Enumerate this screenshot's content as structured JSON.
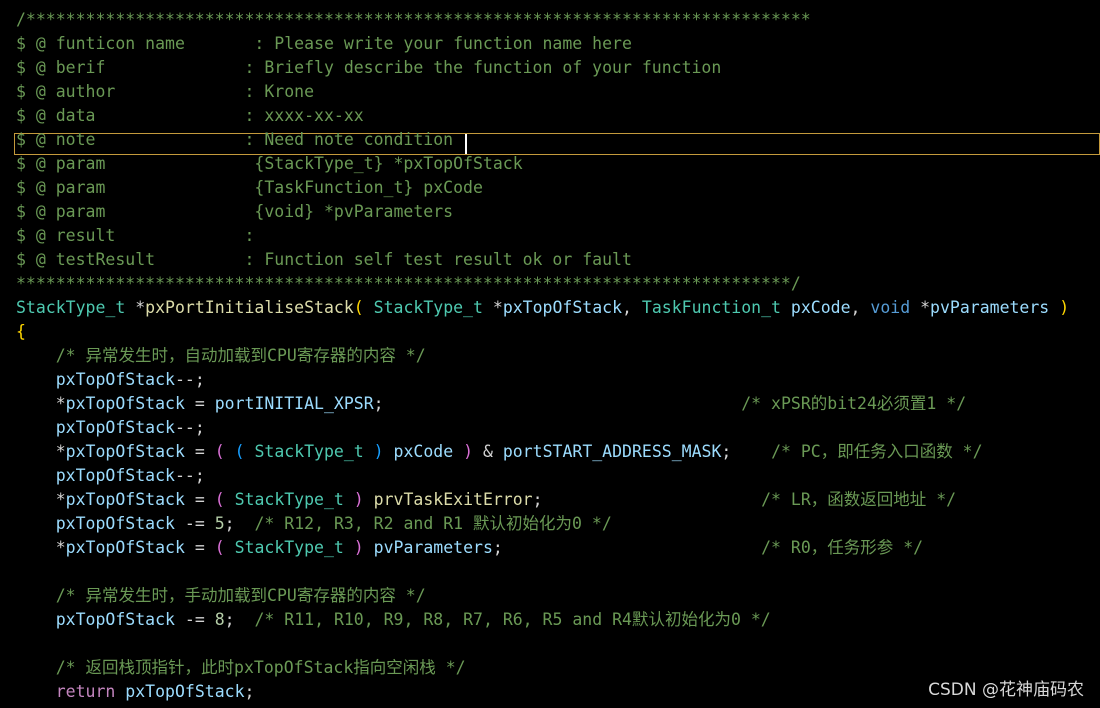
{
  "colors": {
    "background": "#000000",
    "plain": "#d4d4d4",
    "comment": "#6a9955",
    "type": "#4ec9b0",
    "identifier": "#9cdcfe",
    "function": "#dcdcaa",
    "keyword": "#569cd6",
    "control_keyword": "#c586c0",
    "bracket_gold": "#ffd700",
    "bracket_violet": "#da70d6",
    "bracket_blue": "#179fff",
    "number": "#b5cea8",
    "current_line_border": "#c49a3c"
  },
  "code_lines": [
    [
      [
        "/*******************************************************************************",
        "comment"
      ]
    ],
    [
      [
        "$ @ funticon name       : Please write your function name here",
        "comment"
      ]
    ],
    [
      [
        "$ @ berif              : Briefly describe the function of your function",
        "comment"
      ]
    ],
    [
      [
        "$ @ author             : Krone",
        "comment"
      ]
    ],
    [
      [
        "$ @ data               : xxxx-xx-xx",
        "comment"
      ]
    ],
    [
      [
        "$ @ note               : Need note condition",
        "comment"
      ]
    ],
    [
      [
        "$ @ param               {StackType_t} *pxTopOfStack",
        "comment"
      ]
    ],
    [
      [
        "$ @ param               {TaskFunction_t} pxCode",
        "comment"
      ]
    ],
    [
      [
        "$ @ param               {void} *pvParameters",
        "comment"
      ]
    ],
    [
      [
        "$ @ result             :",
        "comment"
      ]
    ],
    [
      [
        "$ @ testResult         : Function self test result ok or fault",
        "comment"
      ]
    ],
    [
      [
        "******************************************************************************/",
        "comment"
      ]
    ],
    [
      [
        "StackType_t",
        "type"
      ],
      [
        " *",
        "plain"
      ],
      [
        "pxPortInitialiseStack",
        "function"
      ],
      [
        "(",
        "bracket_gold"
      ],
      [
        " ",
        "plain"
      ],
      [
        "StackType_t",
        "type"
      ],
      [
        " *",
        "plain"
      ],
      [
        "pxTopOfStack",
        "identifier"
      ],
      [
        ", ",
        "plain"
      ],
      [
        "TaskFunction_t",
        "type"
      ],
      [
        " ",
        "plain"
      ],
      [
        "pxCode",
        "identifier"
      ],
      [
        ", ",
        "plain"
      ],
      [
        "void",
        "keyword"
      ],
      [
        " *",
        "plain"
      ],
      [
        "pvParameters",
        "identifier"
      ],
      [
        " ",
        "plain"
      ],
      [
        ")",
        "bracket_gold"
      ]
    ],
    [
      [
        "{",
        "bracket_gold"
      ]
    ],
    [
      [
        "    ",
        "plain"
      ],
      [
        "/* 异常发生时，自动加载到CPU寄存器的内容 */",
        "comment"
      ]
    ],
    [
      [
        "    ",
        "plain"
      ],
      [
        "pxTopOfStack",
        "identifier"
      ],
      [
        "--;",
        "plain"
      ]
    ],
    [
      [
        "    *",
        "plain"
      ],
      [
        "pxTopOfStack",
        "identifier"
      ],
      [
        " = ",
        "plain"
      ],
      [
        "portINITIAL_XPSR",
        "identifier"
      ],
      [
        ";                                    ",
        "plain"
      ],
      [
        "/* xPSR的bit24必须置1 */",
        "comment"
      ]
    ],
    [
      [
        "    ",
        "plain"
      ],
      [
        "pxTopOfStack",
        "identifier"
      ],
      [
        "--;",
        "plain"
      ]
    ],
    [
      [
        "    *",
        "plain"
      ],
      [
        "pxTopOfStack",
        "identifier"
      ],
      [
        " = ",
        "plain"
      ],
      [
        "(",
        "bracket_violet"
      ],
      [
        " ",
        "plain"
      ],
      [
        "(",
        "bracket_blue"
      ],
      [
        " ",
        "plain"
      ],
      [
        "StackType_t",
        "type"
      ],
      [
        " ",
        "plain"
      ],
      [
        ")",
        "bracket_blue"
      ],
      [
        " ",
        "plain"
      ],
      [
        "pxCode",
        "identifier"
      ],
      [
        " ",
        "plain"
      ],
      [
        ")",
        "bracket_violet"
      ],
      [
        " & ",
        "plain"
      ],
      [
        "portSTART_ADDRESS_MASK",
        "identifier"
      ],
      [
        ";    ",
        "plain"
      ],
      [
        "/* PC，即任务入口函数 */",
        "comment"
      ]
    ],
    [
      [
        "    ",
        "plain"
      ],
      [
        "pxTopOfStack",
        "identifier"
      ],
      [
        "--;",
        "plain"
      ]
    ],
    [
      [
        "    *",
        "plain"
      ],
      [
        "pxTopOfStack",
        "identifier"
      ],
      [
        " = ",
        "plain"
      ],
      [
        "(",
        "bracket_violet"
      ],
      [
        " ",
        "plain"
      ],
      [
        "StackType_t",
        "type"
      ],
      [
        " ",
        "plain"
      ],
      [
        ")",
        "bracket_violet"
      ],
      [
        " ",
        "plain"
      ],
      [
        "prvTaskExitError",
        "function"
      ],
      [
        ";                      ",
        "plain"
      ],
      [
        "/* LR，函数返回地址 */",
        "comment"
      ]
    ],
    [
      [
        "    ",
        "plain"
      ],
      [
        "pxTopOfStack",
        "identifier"
      ],
      [
        " -= ",
        "plain"
      ],
      [
        "5",
        "number"
      ],
      [
        ";  ",
        "plain"
      ],
      [
        "/* R12, R3, R2 and R1 默认初始化为0 */",
        "comment"
      ]
    ],
    [
      [
        "    *",
        "plain"
      ],
      [
        "pxTopOfStack",
        "identifier"
      ],
      [
        " = ",
        "plain"
      ],
      [
        "(",
        "bracket_violet"
      ],
      [
        " ",
        "plain"
      ],
      [
        "StackType_t",
        "type"
      ],
      [
        " ",
        "plain"
      ],
      [
        ")",
        "bracket_violet"
      ],
      [
        " ",
        "plain"
      ],
      [
        "pvParameters",
        "identifier"
      ],
      [
        ";                          ",
        "plain"
      ],
      [
        "/* R0，任务形参 */",
        "comment"
      ]
    ],
    [],
    [
      [
        "    ",
        "plain"
      ],
      [
        "/* 异常发生时，手动加载到CPU寄存器的内容 */",
        "comment"
      ]
    ],
    [
      [
        "    ",
        "plain"
      ],
      [
        "pxTopOfStack",
        "identifier"
      ],
      [
        " -= ",
        "plain"
      ],
      [
        "8",
        "number"
      ],
      [
        ";  ",
        "plain"
      ],
      [
        "/* R11, R10, R9, R8, R7, R6, R5 and R4默认初始化为0 */",
        "comment"
      ]
    ],
    [],
    [
      [
        "    ",
        "plain"
      ],
      [
        "/* 返回栈顶指针，此时pxTopOfStack指向空闲栈 */",
        "comment"
      ]
    ],
    [
      [
        "    ",
        "plain"
      ],
      [
        "return",
        "control_keyword"
      ],
      [
        " ",
        "plain"
      ],
      [
        "pxTopOfStack",
        "identifier"
      ],
      [
        ";",
        "plain"
      ]
    ]
  ],
  "current_line_index": 5,
  "watermark": "CSDN @花神庙码农"
}
